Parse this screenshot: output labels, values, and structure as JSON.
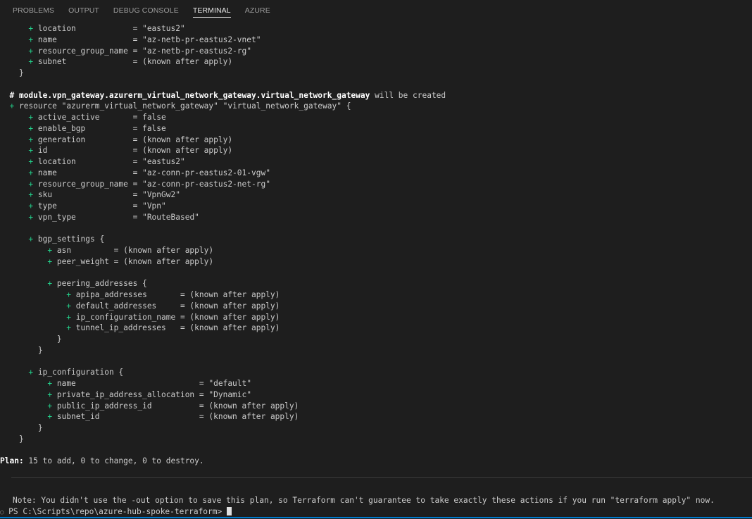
{
  "tabs": [
    "PROBLEMS",
    "OUTPUT",
    "DEBUG CONSOLE",
    "TERMINAL",
    "AZURE"
  ],
  "lines": [
    {
      "ind": "      ",
      "plus": "+ ",
      "text": "location            = \"eastus2\""
    },
    {
      "ind": "      ",
      "plus": "+ ",
      "text": "name                = \"az-netb-pr-eastus2-vnet\""
    },
    {
      "ind": "      ",
      "plus": "+ ",
      "text": "resource_group_name = \"az-netb-pr-eastus2-rg\""
    },
    {
      "ind": "      ",
      "plus": "+ ",
      "text": "subnet              = (known after apply)"
    },
    {
      "ind": "    ",
      "plus": "",
      "text": "}"
    },
    {
      "ind": "",
      "plus": "",
      "text": ""
    },
    {
      "ind": "  ",
      "plus": "",
      "bold": "# module.vpn_gateway.azurerm_virtual_network_gateway.virtual_network_gateway",
      "text": " will be created"
    },
    {
      "ind": "  ",
      "plus": "+ ",
      "text": "resource \"azurerm_virtual_network_gateway\" \"virtual_network_gateway\" {"
    },
    {
      "ind": "      ",
      "plus": "+ ",
      "text": "active_active       = false"
    },
    {
      "ind": "      ",
      "plus": "+ ",
      "text": "enable_bgp          = false"
    },
    {
      "ind": "      ",
      "plus": "+ ",
      "text": "generation          = (known after apply)"
    },
    {
      "ind": "      ",
      "plus": "+ ",
      "text": "id                  = (known after apply)"
    },
    {
      "ind": "      ",
      "plus": "+ ",
      "text": "location            = \"eastus2\""
    },
    {
      "ind": "      ",
      "plus": "+ ",
      "text": "name                = \"az-conn-pr-eastus2-01-vgw\""
    },
    {
      "ind": "      ",
      "plus": "+ ",
      "text": "resource_group_name = \"az-conn-pr-eastus2-net-rg\""
    },
    {
      "ind": "      ",
      "plus": "+ ",
      "text": "sku                 = \"VpnGw2\""
    },
    {
      "ind": "      ",
      "plus": "+ ",
      "text": "type                = \"Vpn\""
    },
    {
      "ind": "      ",
      "plus": "+ ",
      "text": "vpn_type            = \"RouteBased\""
    },
    {
      "ind": "",
      "plus": "",
      "text": ""
    },
    {
      "ind": "      ",
      "plus": "+ ",
      "text": "bgp_settings {"
    },
    {
      "ind": "          ",
      "plus": "+ ",
      "text": "asn         = (known after apply)"
    },
    {
      "ind": "          ",
      "plus": "+ ",
      "text": "peer_weight = (known after apply)"
    },
    {
      "ind": "",
      "plus": "",
      "text": ""
    },
    {
      "ind": "          ",
      "plus": "+ ",
      "text": "peering_addresses {"
    },
    {
      "ind": "              ",
      "plus": "+ ",
      "text": "apipa_addresses       = (known after apply)"
    },
    {
      "ind": "              ",
      "plus": "+ ",
      "text": "default_addresses     = (known after apply)"
    },
    {
      "ind": "              ",
      "plus": "+ ",
      "text": "ip_configuration_name = (known after apply)"
    },
    {
      "ind": "              ",
      "plus": "+ ",
      "text": "tunnel_ip_addresses   = (known after apply)"
    },
    {
      "ind": "            ",
      "plus": "",
      "text": "}"
    },
    {
      "ind": "        ",
      "plus": "",
      "text": "}"
    },
    {
      "ind": "",
      "plus": "",
      "text": ""
    },
    {
      "ind": "      ",
      "plus": "+ ",
      "text": "ip_configuration {"
    },
    {
      "ind": "          ",
      "plus": "+ ",
      "text": "name                          = \"default\""
    },
    {
      "ind": "          ",
      "plus": "+ ",
      "text": "private_ip_address_allocation = \"Dynamic\""
    },
    {
      "ind": "          ",
      "plus": "+ ",
      "text": "public_ip_address_id          = (known after apply)"
    },
    {
      "ind": "          ",
      "plus": "+ ",
      "text": "subnet_id                     = (known after apply)"
    },
    {
      "ind": "        ",
      "plus": "",
      "text": "}"
    },
    {
      "ind": "    ",
      "plus": "",
      "text": "}"
    },
    {
      "ind": "",
      "plus": "",
      "text": ""
    },
    {
      "ind": "",
      "plus": "",
      "bold": "Plan:",
      "text": " 15 to add, 0 to change, 0 to destroy."
    }
  ],
  "note": "Note: You didn't use the -out option to save this plan, so Terraform can't guarantee to take exactly these actions if you run \"terraform apply\" now.",
  "prompt_dot": "○",
  "prompt": " PS C:\\Scripts\\repo\\azure-hub-spoke-terraform> "
}
